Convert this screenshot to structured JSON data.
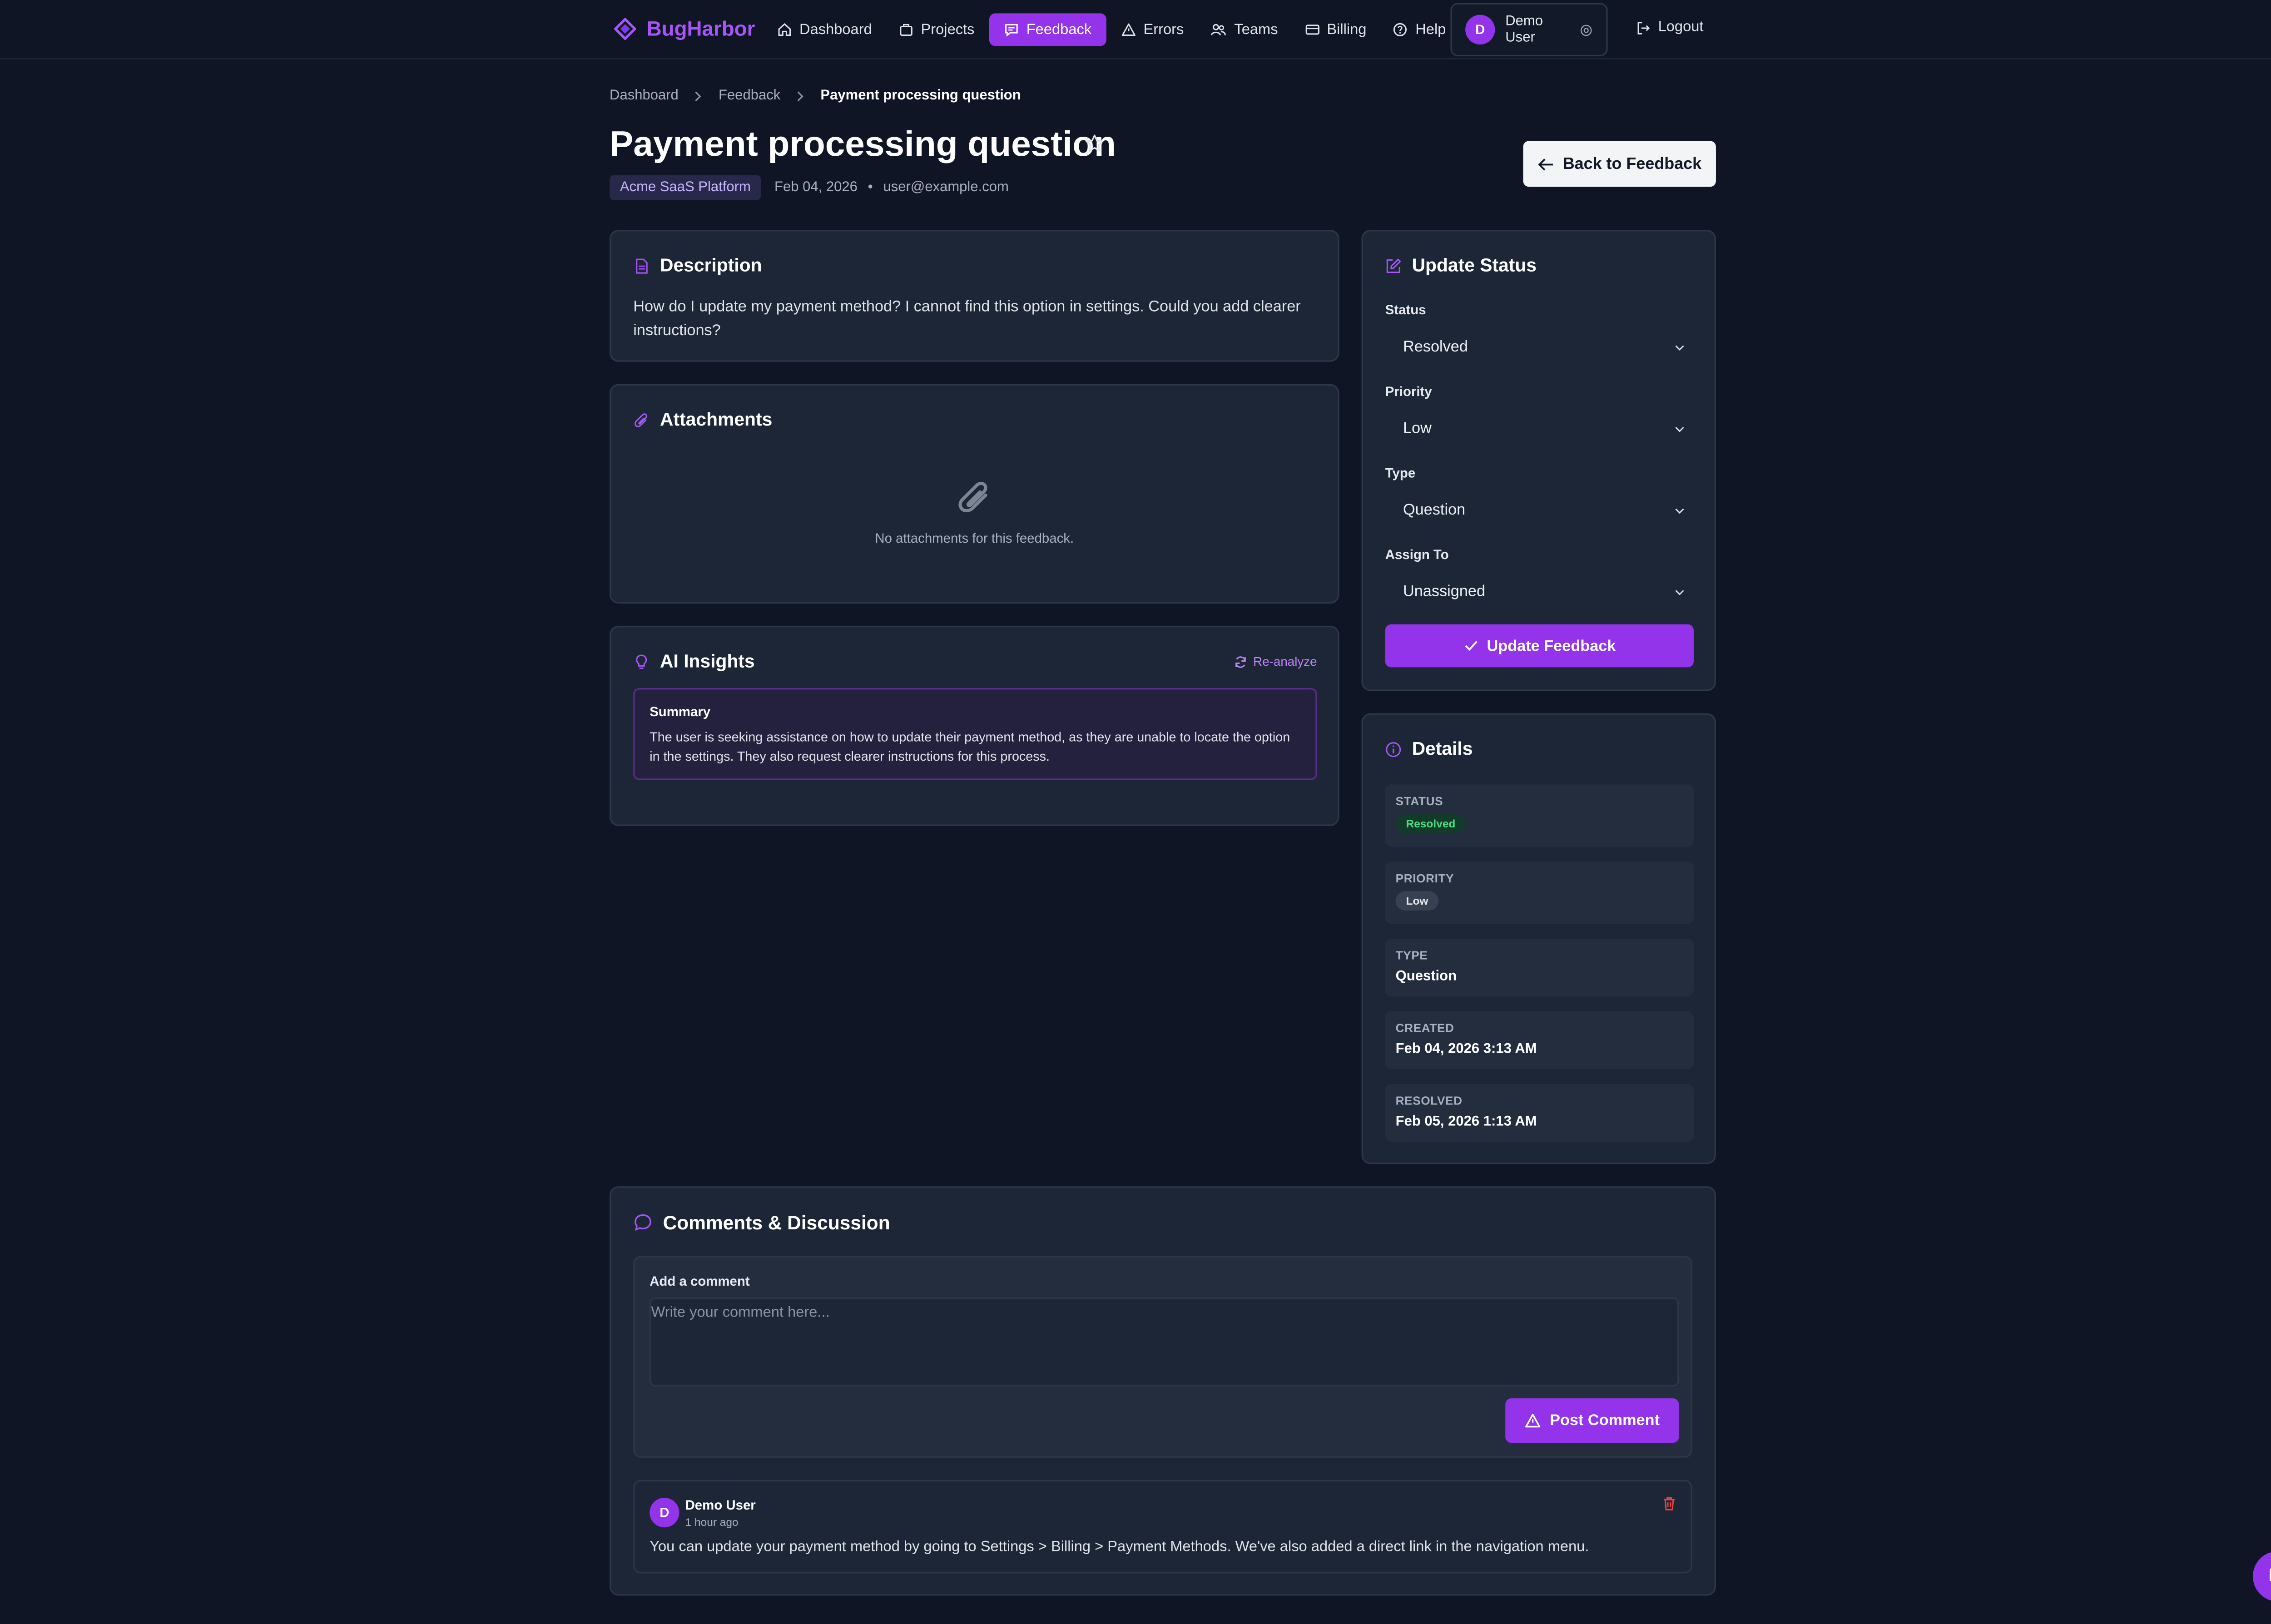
{
  "brand": {
    "name": "BugHarbor"
  },
  "nav": {
    "items": [
      {
        "label": "Dashboard",
        "icon": "home-icon"
      },
      {
        "label": "Projects",
        "icon": "projects-icon"
      },
      {
        "label": "Feedback",
        "icon": "feedback-icon",
        "active": true
      },
      {
        "label": "Errors",
        "icon": "warning-icon"
      },
      {
        "label": "Teams",
        "icon": "team-icon"
      },
      {
        "label": "Billing",
        "icon": "billing-icon"
      },
      {
        "label": "Help",
        "icon": "help-icon"
      }
    ],
    "user": {
      "initial": "D",
      "name": "Demo User"
    },
    "logout": "Logout"
  },
  "breadcrumb": [
    "Dashboard",
    "Feedback",
    "Payment processing question"
  ],
  "page": {
    "title": "Payment processing question",
    "project": "Acme SaaS Platform",
    "date": "Feb 04, 2026",
    "separator": "•",
    "email": "user@example.com",
    "back_label": "Back to Feedback"
  },
  "description": {
    "title": "Description",
    "text": "How do I update my payment method? I cannot find this option in settings. Could you add clearer instructions?"
  },
  "attachments": {
    "title": "Attachments",
    "empty_text": "No attachments for this feedback."
  },
  "ai": {
    "title": "AI Insights",
    "reanalyze": "Re-analyze",
    "summary_title": "Summary",
    "summary_text": "The user is seeking assistance on how to update their payment method, as they are unable to locate the option in the settings. They also request clearer instructions for this process."
  },
  "update_status": {
    "title": "Update Status",
    "status_label": "Status",
    "status_value": "Resolved",
    "priority_label": "Priority",
    "priority_value": "Low",
    "type_label": "Type",
    "type_value": "Question",
    "assign_label": "Assign To",
    "assign_value": "Unassigned",
    "button": "Update Feedback"
  },
  "details": {
    "title": "Details",
    "status_label": "STATUS",
    "status_value": "Resolved",
    "priority_label": "PRIORITY",
    "priority_value": "Low",
    "type_label": "TYPE",
    "type_value": "Question",
    "created_label": "CREATED",
    "created_value": "Feb 04, 2026 3:13 AM",
    "resolved_label": "RESOLVED",
    "resolved_value": "Feb 05, 2026 1:13 AM"
  },
  "comments": {
    "title": "Comments & Discussion",
    "add_label": "Add a comment",
    "placeholder": "Write your comment here...",
    "post_button": "Post Comment",
    "items": [
      {
        "initial": "D",
        "author": "Demo User",
        "time": "1 hour ago",
        "text": "You can update your payment method by going to Settings > Billing > Payment Methods. We've also added a direct link in the navigation menu."
      }
    ]
  },
  "colors": {
    "accent": "#9333ea",
    "background": "#0f1524",
    "card": "#1c2636",
    "success": "#4ade80",
    "danger": "#ef4444"
  }
}
